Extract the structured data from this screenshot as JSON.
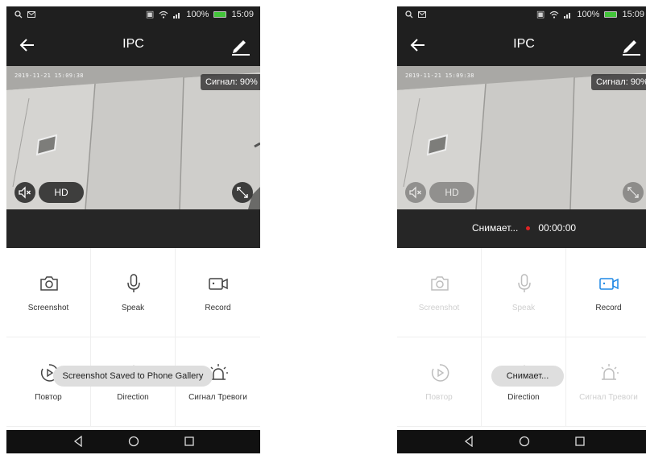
{
  "status_bar": {
    "battery": "100%",
    "time": "15:09"
  },
  "app_bar": {
    "title": "IPC"
  },
  "video": {
    "timestamp": "2019-11-21 15:09:38",
    "signal": "Сигнал: 90%",
    "quality": "HD"
  },
  "recording": {
    "label": "Снимает...",
    "timer": "00:00:00"
  },
  "controls": {
    "screenshot": "Screenshot",
    "speak": "Speak",
    "record": "Record",
    "playback": "Повтор",
    "direction": "Direction",
    "alarm": "Сигнал Тревоги"
  },
  "toasts": {
    "screenshot_saved": "Screenshot Saved to Phone Gallery",
    "recording": "Снимает..."
  },
  "colors": {
    "toolbar_bg": "#1f1f1f",
    "accent_blue": "#1e88e5",
    "record_dot": "#e02424",
    "battery_green": "#43c43a"
  }
}
